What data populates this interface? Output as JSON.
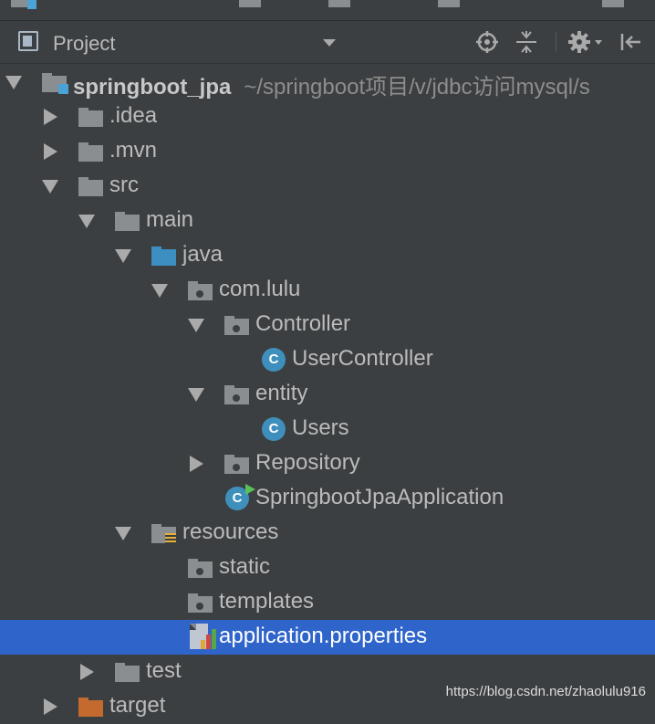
{
  "panel": {
    "title": "Project"
  },
  "tree": {
    "root": {
      "label": "springboot_jpa",
      "path": "~/springboot项目/v/jdbc访问mysql/s"
    },
    "idea": "idea",
    "mvn": "mvn",
    "src": "src",
    "main": "main",
    "java": "java",
    "com_lulu": "com.lulu",
    "controller": "Controller",
    "user_controller": "UserController",
    "entity": "entity",
    "users": "Users",
    "repository": "Repository",
    "app_class": "SpringbootJpaApplication",
    "resources": "resources",
    "static": "static",
    "templates": "templates",
    "app_props": "application.properties",
    "test": "test",
    "target": "target",
    "class_glyph": "C"
  },
  "watermark": "https://blog.csdn.net/zhaolulu916",
  "colors": {
    "background": "#3c3f41",
    "selection": "#2f65ca",
    "folder": "#8a8e90",
    "source_folder": "#3d8fc2",
    "class_icon": "#3f8fbd"
  },
  "icons": {
    "header": [
      "project-view-icon",
      "dropdown-icon",
      "locate-icon",
      "collapse-all-icon",
      "gear-icon",
      "hide-panel-icon"
    ]
  }
}
